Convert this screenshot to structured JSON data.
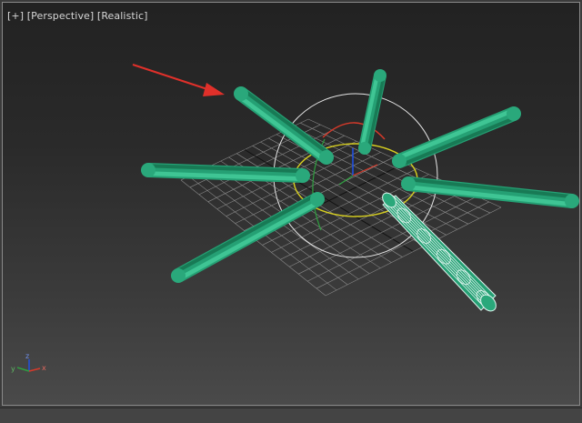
{
  "viewport": {
    "menus": [
      {
        "id": "plus",
        "label": "[+]"
      },
      {
        "id": "view",
        "label": "[Perspective]"
      },
      {
        "id": "shading",
        "label": "[Realistic]"
      }
    ]
  },
  "axis_tripod": {
    "x_label": "x",
    "y_label": "y",
    "z_label": "z"
  },
  "colors": {
    "cylinder_fill": "#25a074",
    "cylinder_highlight": "#3fc594",
    "cylinder_shadow": "#187a55",
    "selected_wire": "#dff5ef",
    "grid": "#8a8a8a",
    "annotation_arrow": "#e0302a",
    "gizmo_x": "#d83a2a",
    "gizmo_y": "#d8d020",
    "gizmo_z": "#2050e0",
    "gizmo_sphere": "#e6e6e6"
  }
}
